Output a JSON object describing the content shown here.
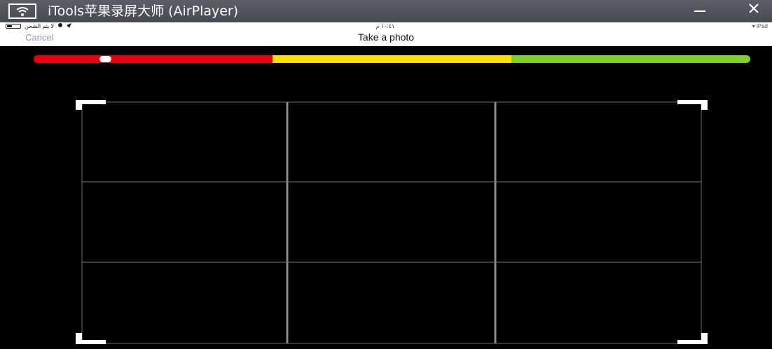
{
  "window": {
    "title": "iTools苹果录屏大师 (AirPlayer)",
    "minimize_label": "—",
    "close_label": "✕"
  },
  "status_bar": {
    "left_text": "لا يتم الشحن",
    "time": "١٠:٤١ م",
    "right_text": "iPad",
    "battery_level": 0.4
  },
  "nav": {
    "cancel_label": "Cancel",
    "title": "Take a photo"
  },
  "level_bar": {
    "segments": [
      {
        "color": "#e8000f",
        "fraction": 0.333
      },
      {
        "color": "#ffe000",
        "fraction": 0.334
      },
      {
        "color": "#7dd12a",
        "fraction": 0.333
      }
    ],
    "indicator_value": 0.1
  },
  "colors": {
    "titlebar": "#4f535b",
    "camera_bg": "#000000",
    "cancel": "#9a94c6"
  }
}
